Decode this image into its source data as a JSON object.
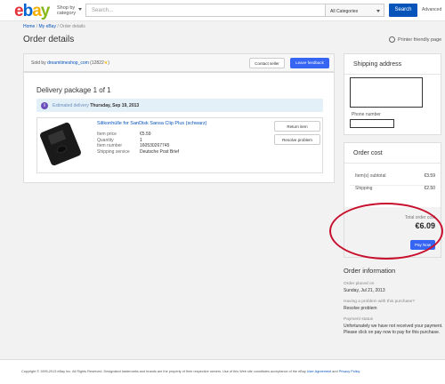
{
  "header": {
    "logo": {
      "e": "e",
      "b": "b",
      "a": "a",
      "y": "y"
    },
    "shop_by": "Shop by category",
    "search_placeholder": "Search...",
    "category": "All Categories",
    "search_button": "Search",
    "advanced": "Advanced"
  },
  "breadcrumb": {
    "home": "Home",
    "my_ebay": "My eBay",
    "current": "Order details",
    "separator": "/"
  },
  "page_title": "Order details",
  "printer_link": "Printer friendly page",
  "seller": {
    "sold_by_label": "Sold by",
    "name": "dreamtimeshop_com",
    "rating": "(12822",
    "star": "★",
    "rating_close": ")",
    "contact_button": "Contact seller",
    "feedback_button": "Leave feedback"
  },
  "package": {
    "title": "Delivery package 1 of 1",
    "estimated_label": "Estimated delivery",
    "estimated_date": "Thursday, Sep 19, 2013"
  },
  "item": {
    "title": "Silikonhülle for SanDisk Sansa Clip Plus (schwarz)",
    "labels": [
      "Item price",
      "Quantity",
      "Item number",
      "Shipping service"
    ],
    "values": [
      "€5.59",
      "1",
      "160530267745",
      "Deutsche Post Brief"
    ],
    "return_button": "Return item",
    "resolve_button": "Resolve problem"
  },
  "shipping": {
    "title": "Shipping address",
    "phone_label": "Phone number"
  },
  "cost": {
    "title": "Order cost",
    "subtotal_label": "Item(s) subtotal",
    "subtotal_value": "€3.59",
    "shipping_label": "Shipping",
    "shipping_value": "€2.50",
    "total_label": "Total order cost",
    "total_value": "€6.09",
    "pay_button": "Pay Now"
  },
  "order_info": {
    "title": "Order information",
    "placed_label": "Order placed on",
    "placed_value": "Sunday, Jul 21, 2013",
    "problem_label": "Having a problem with this purchase?",
    "problem_value": "Resolve problem",
    "payment_label": "Payment status",
    "payment_value": "Unfortunately we have not received your payment. Please click on pay now to pay for this purchase."
  },
  "footer": {
    "text": "Copyright © 1995-2013 eBay Inc. All Rights Reserved. Designated trademarks and brands are the property of their respective owners. Use of this Web site constitutes acceptance of the eBay",
    "user_agreement": "User Agreement",
    "and": "and",
    "privacy": "Privacy Policy",
    "end": "."
  },
  "colors": {
    "ebay_e": "#e53238",
    "ebay_b": "#0064d2",
    "ebay_a": "#f5af02",
    "ebay_y": "#86b817",
    "accent": "#3665f3",
    "annotation": "#c8102e"
  }
}
